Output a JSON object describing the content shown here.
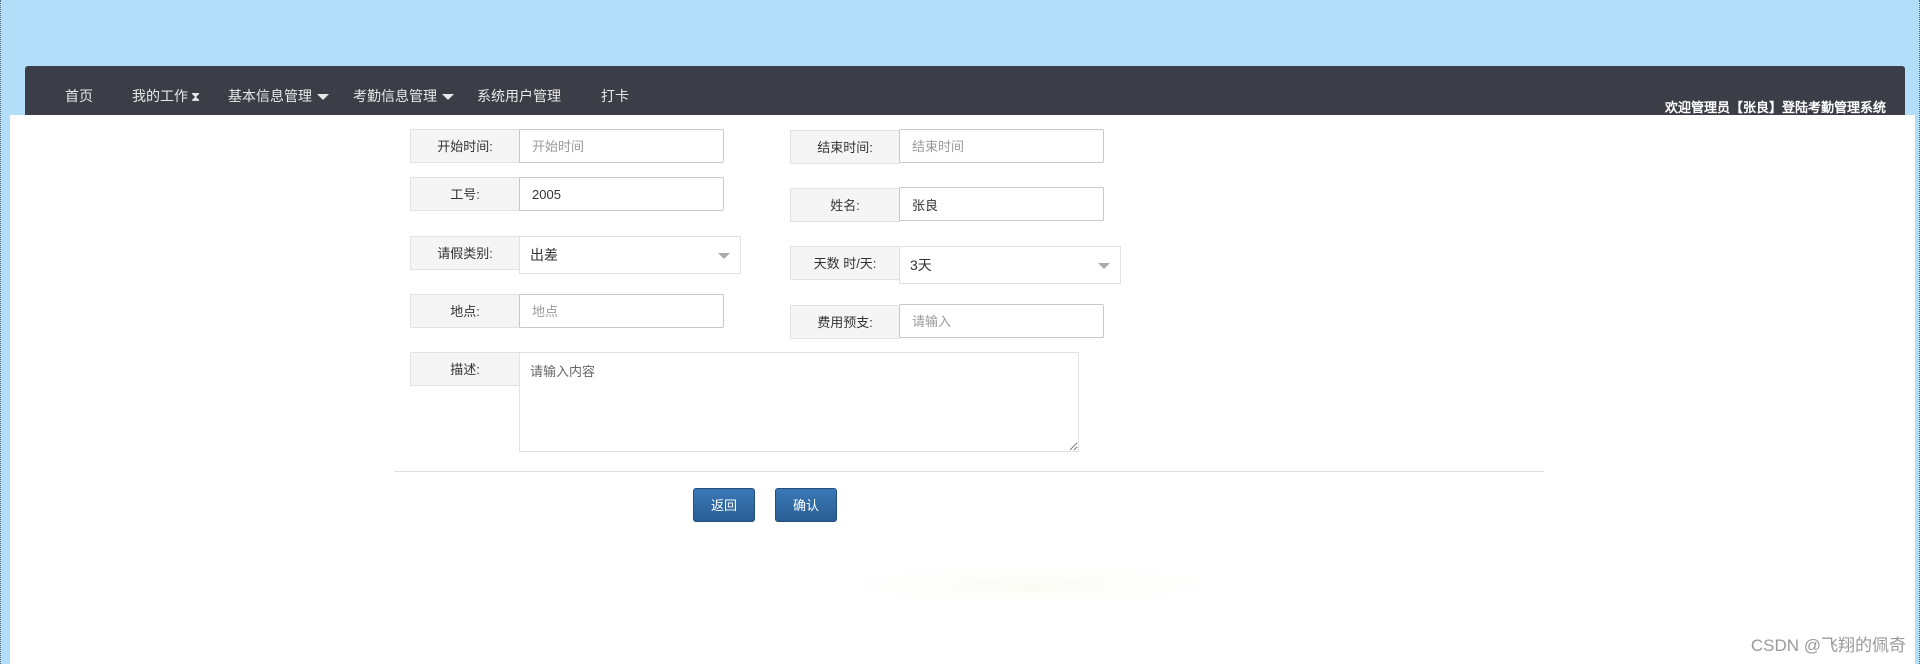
{
  "nav": {
    "items": [
      {
        "label": "首页"
      },
      {
        "label": "我的工作"
      },
      {
        "label": "基本信息管理"
      },
      {
        "label": "考勤信息管理"
      },
      {
        "label": "系统用户管理"
      },
      {
        "label": "打卡"
      }
    ],
    "welcome": "欢迎管理员【张良】登陆考勤管理系统"
  },
  "form": {
    "start_time": {
      "label": "开始时间:",
      "placeholder": "开始时间",
      "value": ""
    },
    "end_time": {
      "label": "结束时间:",
      "placeholder": "结束时间",
      "value": ""
    },
    "job_no": {
      "label": "工号:",
      "value": "2005"
    },
    "name": {
      "label": "姓名:",
      "value": "张良"
    },
    "leave_type": {
      "label": "请假类别:",
      "selected": "出差"
    },
    "days": {
      "label": "天数 时/天:",
      "selected": "3天"
    },
    "location": {
      "label": "地点:",
      "placeholder": "地点",
      "value": ""
    },
    "budget": {
      "label": "费用预支:",
      "placeholder": "请输入",
      "value": ""
    },
    "description": {
      "label": "描述:",
      "placeholder": "请输入内容",
      "value": ""
    }
  },
  "buttons": {
    "back": "返回",
    "confirm": "确认"
  },
  "watermark": "CSDN @飞翔的佩奇"
}
